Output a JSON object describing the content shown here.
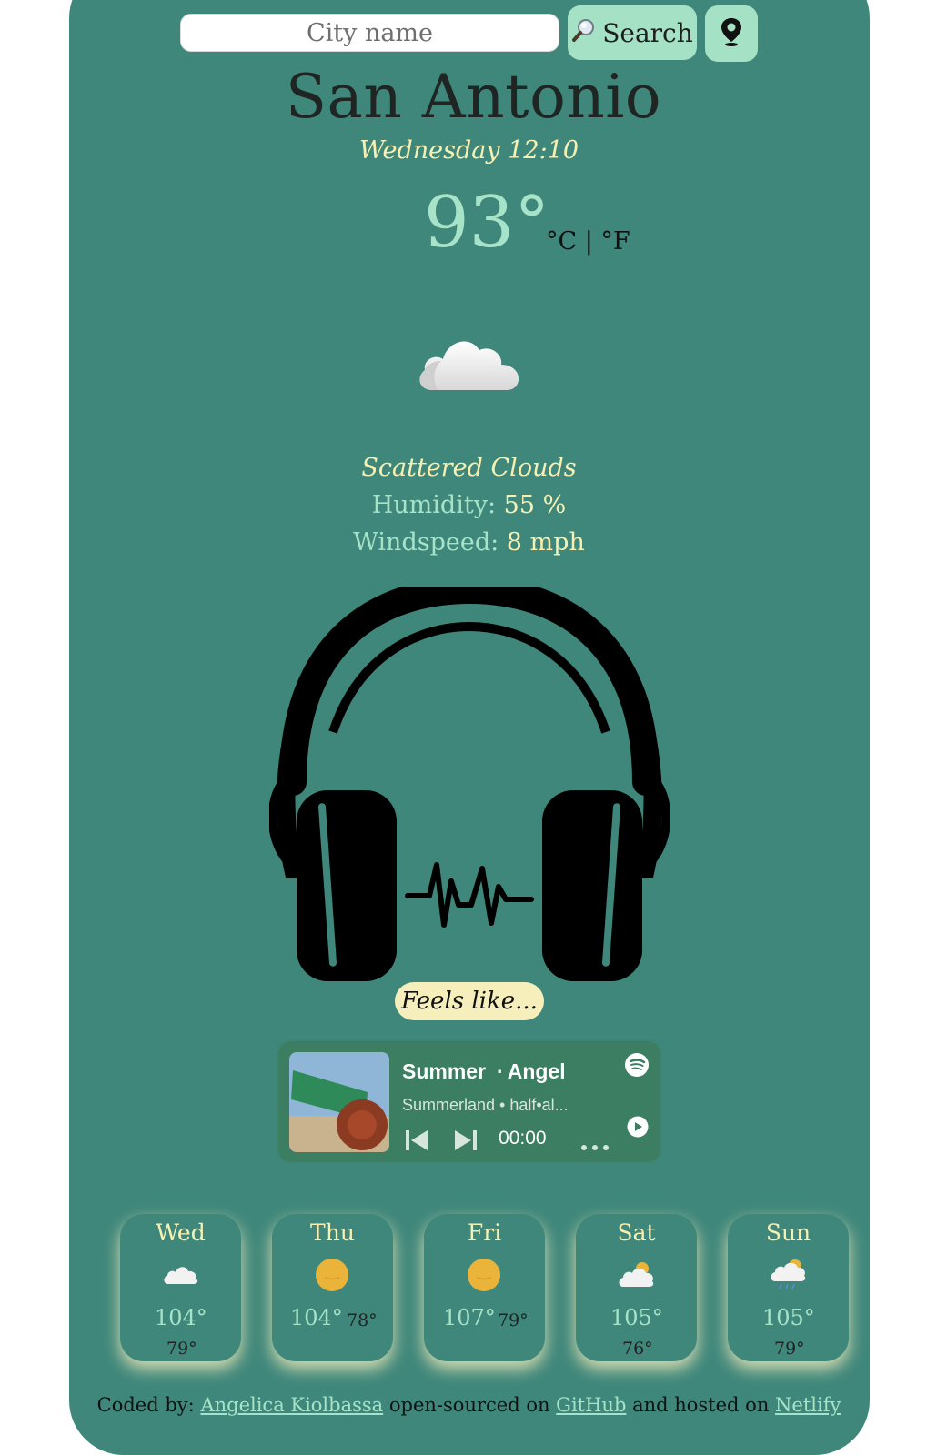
{
  "search": {
    "placeholder": "City name",
    "button_label": "Search"
  },
  "weather": {
    "city": "San Antonio",
    "datetime": "Wednesday 12:10",
    "temperature": "93°",
    "units": "°C | °F",
    "description": "Scattered Clouds",
    "humidity_label": "Humidity:",
    "humidity_value": "55 %",
    "windspeed_label": "Windspeed:",
    "windspeed_value": "8 mph",
    "feels_like_label": "Feels like..."
  },
  "player": {
    "track": "Summer",
    "artist": "Angel",
    "separator": "·",
    "album_line": "Summerland  •  half•al...",
    "time": "00:00"
  },
  "forecast": [
    {
      "day": "Wed",
      "high": "104°",
      "low": "79°",
      "icon": "cloud-icon"
    },
    {
      "day": "Thu",
      "high": "104°",
      "low": "78°",
      "icon": "sun-icon"
    },
    {
      "day": "Fri",
      "high": "107°",
      "low": "79°",
      "icon": "sun-icon"
    },
    {
      "day": "Sat",
      "high": "105°",
      "low": "76°",
      "icon": "partly-cloudy-icon"
    },
    {
      "day": "Sun",
      "high": "105°",
      "low": "79°",
      "icon": "rain-sun-icon"
    }
  ],
  "footer": {
    "coded_by": "Coded by:",
    "author": "Angelica Kiolbassa",
    "open_sourced": "open-sourced on",
    "github": "GitHub",
    "hosted": "and hosted on",
    "netlify": "Netlify"
  },
  "colors": {
    "card": "#3f877b",
    "accent_mint": "#a6e3c8",
    "accent_cream": "#f6f0b3",
    "player_bg": "#3b7e62"
  }
}
